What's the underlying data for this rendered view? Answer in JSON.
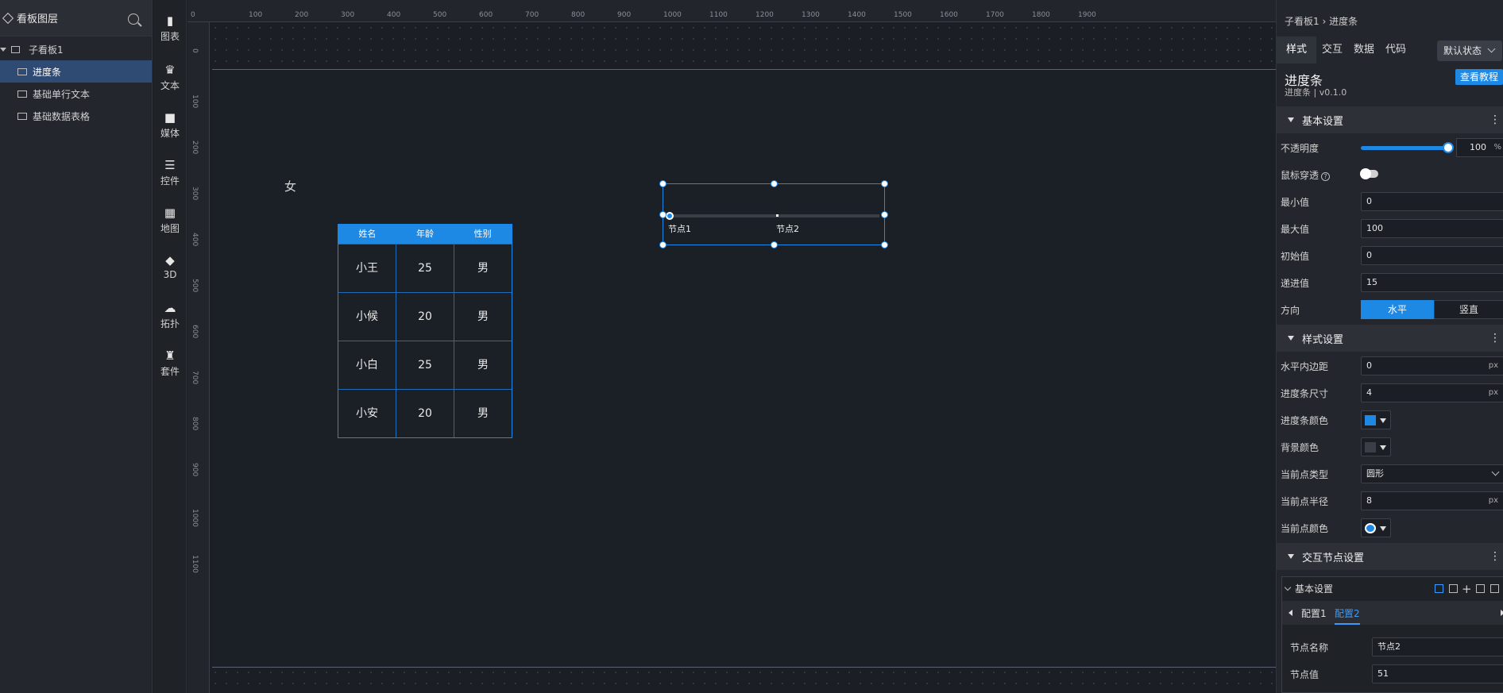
{
  "layers": {
    "title": "看板图层",
    "root": "子看板1",
    "items": [
      "进度条",
      "基础单行文本",
      "基础数据表格"
    ]
  },
  "tools": [
    "图表",
    "文本",
    "媒体",
    "控件",
    "地图",
    "3D",
    "拓扑",
    "套件"
  ],
  "ruler": {
    "top": [
      "0",
      "100",
      "200",
      "300",
      "400",
      "500",
      "600",
      "700",
      "800",
      "900",
      "1000",
      "1100",
      "1200",
      "1300",
      "1400",
      "1500",
      "1600",
      "1700",
      "1800",
      "1900"
    ],
    "left": [
      "0",
      "100",
      "200",
      "300",
      "400",
      "500",
      "600",
      "700",
      "800",
      "900",
      "1000",
      "1100"
    ]
  },
  "canvas": {
    "floating_text": "女",
    "table": {
      "headers": [
        "姓名",
        "年龄",
        "性别"
      ],
      "rows": [
        [
          "小王",
          "25",
          "男"
        ],
        [
          "小候",
          "20",
          "男"
        ],
        [
          "小白",
          "25",
          "男"
        ],
        [
          "小安",
          "20",
          "男"
        ]
      ]
    },
    "progress": {
      "node1": "节点1",
      "node2": "节点2",
      "value_fraction": 0.0
    }
  },
  "props": {
    "breadcrumb": "子看板1 › 进度条",
    "tabs": [
      "样式",
      "交互",
      "数据",
      "代码"
    ],
    "state": "默认状态",
    "component_title": "进度条",
    "component_version": "进度条 | v0.1.0",
    "tutorial": "查看教程",
    "basic": {
      "title": "基本设置",
      "opacity_label": "不透明度",
      "opacity": "100",
      "opacity_unit": "%",
      "passthrough_label": "鼠标穿透",
      "min_label": "最小值",
      "min": "0",
      "max_label": "最大值",
      "max": "100",
      "init_label": "初始值",
      "init": "0",
      "step_label": "递进值",
      "step": "15",
      "dir_label": "方向",
      "dir_h": "水平",
      "dir_v": "竖直"
    },
    "style": {
      "title": "样式设置",
      "hpad_label": "水平内边距",
      "hpad": "0",
      "size_label": "进度条尺寸",
      "size": "4",
      "unit": "px",
      "bar_color_label": "进度条颜色",
      "bar_color": "#1e88e5",
      "bg_color_label": "背景颜色",
      "bg_color": "#3a3e46",
      "point_type_label": "当前点类型",
      "point_type": "圆形",
      "point_radius_label": "当前点半径",
      "point_radius": "8",
      "point_color_label": "当前点颜色",
      "point_color": "#1e88e5"
    },
    "nodes": {
      "title": "交互节点设置",
      "sub_title": "基本设置",
      "cfg_tabs": [
        "配置1",
        "配置2"
      ],
      "name_label": "节点名称",
      "name": "节点2",
      "value_label": "节点值",
      "value": "51"
    }
  }
}
